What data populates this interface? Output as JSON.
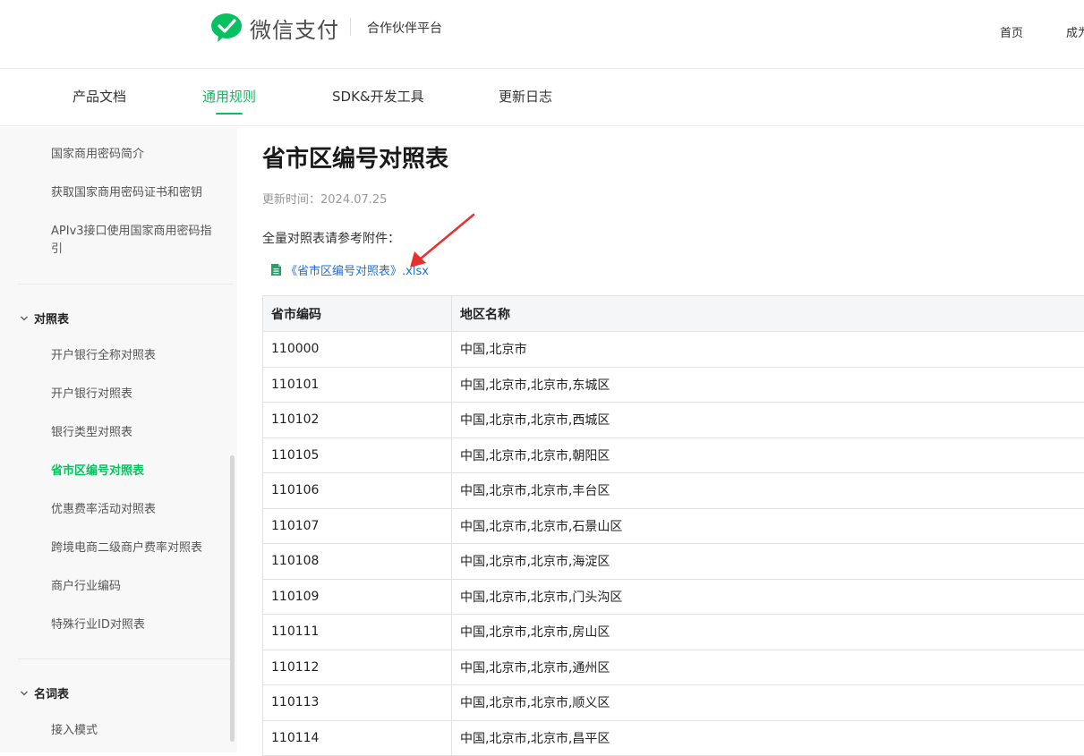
{
  "header": {
    "brand": "微信支付",
    "partner": "合作伙伴平台",
    "nav_home": "首页",
    "nav_cut": "成为"
  },
  "subnav": {
    "tabs": [
      {
        "label": "产品文档"
      },
      {
        "label": "通用规则"
      },
      {
        "label": "SDK&开发工具"
      },
      {
        "label": "更新日志"
      }
    ],
    "active": "通用规则"
  },
  "sidebar": {
    "items_top": [
      "国家商用密码简介",
      "获取国家商用密码证书和密钥",
      "APIv3接口使用国家商用密码指引"
    ],
    "group1": "对照表",
    "group1_items": [
      "开户银行全称对照表",
      "开户银行对照表",
      "银行类型对照表",
      "省市区编号对照表",
      "优惠费率活动对照表",
      "跨境电商二级商户费率对照表",
      "商户行业编码",
      "特殊行业ID对照表"
    ],
    "group2": "名词表",
    "group2_items": [
      "接入模式"
    ]
  },
  "content": {
    "title": "省市区编号对照表",
    "update_time": "更新时间：2024.07.25",
    "intro": "全量对照表请参考附件：",
    "attachment": "《省市区编号对照表》.xlsx",
    "table": {
      "headers": [
        "省市编码",
        "地区名称"
      ],
      "rows": [
        [
          "110000",
          "中国,北京市"
        ],
        [
          "110101",
          "中国,北京市,北京市,东城区"
        ],
        [
          "110102",
          "中国,北京市,北京市,西城区"
        ],
        [
          "110105",
          "中国,北京市,北京市,朝阳区"
        ],
        [
          "110106",
          "中国,北京市,北京市,丰台区"
        ],
        [
          "110107",
          "中国,北京市,北京市,石景山区"
        ],
        [
          "110108",
          "中国,北京市,北京市,海淀区"
        ],
        [
          "110109",
          "中国,北京市,北京市,门头沟区"
        ],
        [
          "110111",
          "中国,北京市,北京市,房山区"
        ],
        [
          "110112",
          "中国,北京市,北京市,通州区"
        ],
        [
          "110113",
          "中国,北京市,北京市,顺义区"
        ],
        [
          "110114",
          "中国,北京市,北京市,昌平区"
        ]
      ]
    }
  },
  "colors": {
    "accent": "#07c160",
    "link": "#1e6fd9",
    "annotation_arrow": "#e8302d"
  },
  "icons": [
    "wechat-pay-logo-icon",
    "chevron-down-icon",
    "xlsx-file-icon",
    "annotation-arrow-icon"
  ]
}
